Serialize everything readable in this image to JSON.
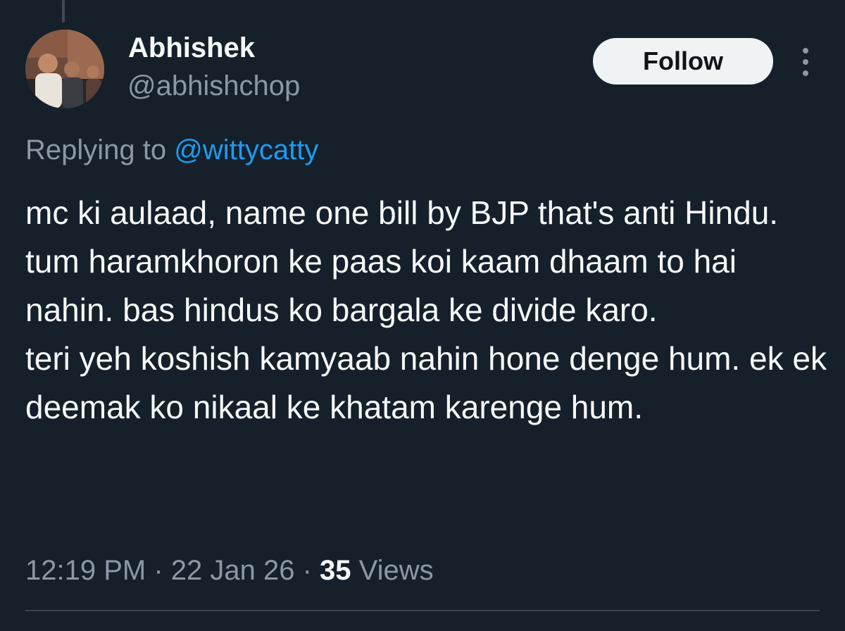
{
  "author": {
    "display_name": "Abhishek",
    "handle": "@abhishchop"
  },
  "follow_button": {
    "label": "Follow"
  },
  "more_icon": "more-dots-vertical-icon",
  "reply": {
    "prefix": "Replying to ",
    "mention": "@wittycatty"
  },
  "tweet": {
    "text": "mc ki aulaad, name one bill by BJP that's anti Hindu. tum haramkhoron ke paas koi kaam dhaam to hai nahin. bas hindus ko bargala ke divide karo.\nteri yeh koshish kamyaab nahin hone denge hum. ek ek deemak ko nikaal ke khatam karenge hum."
  },
  "meta": {
    "time": "12:19 PM",
    "separator": " · ",
    "date": "22 Jan 26",
    "views_count": "35",
    "views_label": " Views"
  },
  "colors": {
    "background": "#15202b",
    "text_primary": "#f7f9f9",
    "text_secondary": "#8b98a5",
    "link": "#1d9bf0",
    "button_bg": "#eff3f4"
  }
}
